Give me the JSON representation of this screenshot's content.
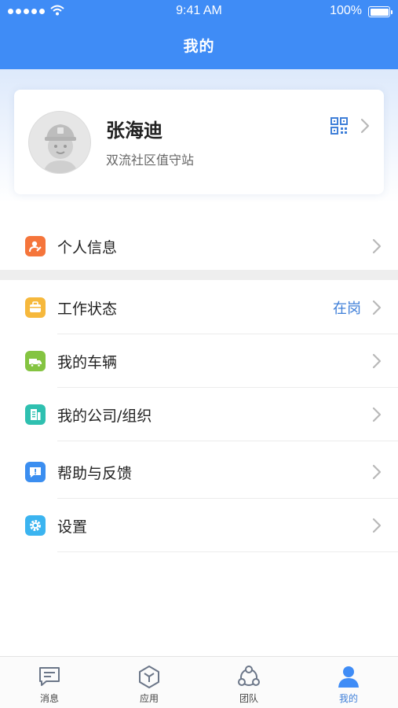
{
  "status_bar": {
    "time": "9:41 AM",
    "battery": "100%"
  },
  "header": {
    "title": "我的"
  },
  "profile": {
    "name": "张海迪",
    "station": "双流社区值守站"
  },
  "menu": [
    {
      "label": "个人信息",
      "icon": "person-edit-icon",
      "color": "#f5753b"
    },
    {
      "label": "工作状态",
      "icon": "briefcase-icon",
      "color": "#f6b83c",
      "value": "在岗"
    },
    {
      "label": "我的车辆",
      "icon": "truck-icon",
      "color": "#84c441"
    },
    {
      "label": "我的公司/组织",
      "icon": "building-icon",
      "color": "#2fc0b0"
    },
    {
      "label": "帮助与反馈",
      "icon": "feedback-icon",
      "color": "#3b8ef0"
    },
    {
      "label": "设置",
      "icon": "gear-icon",
      "color": "#3bb4f0"
    }
  ],
  "tabs": [
    {
      "label": "消息",
      "icon": "message-icon"
    },
    {
      "label": "应用",
      "icon": "apps-cube-icon"
    },
    {
      "label": "团队",
      "icon": "team-icon"
    },
    {
      "label": "我的",
      "icon": "user-icon",
      "active": true
    }
  ],
  "colors": {
    "primary": "#3f8cf6",
    "link": "#3f7fd8"
  }
}
